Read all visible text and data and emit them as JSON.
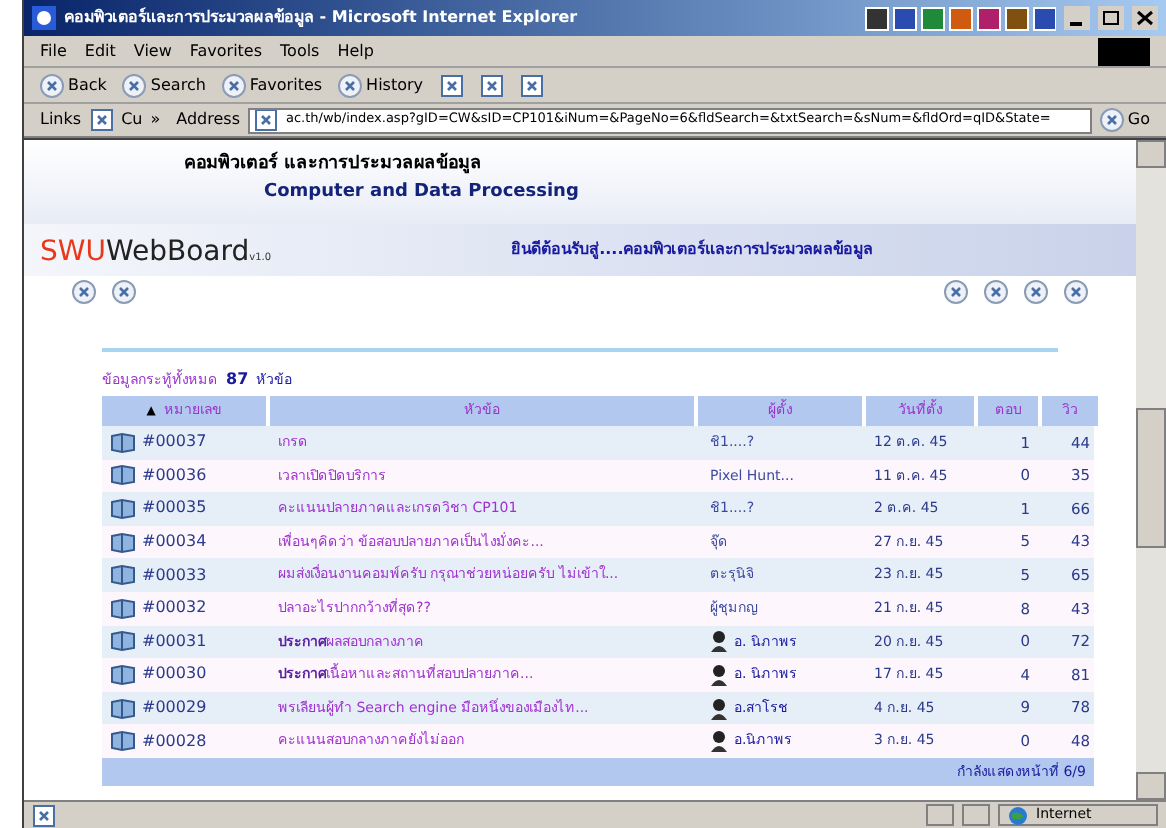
{
  "window": {
    "title": "คอมพิวเตอร์และการประมวลผลข้อมูล - Microsoft Internet Explorer"
  },
  "menu": [
    "File",
    "Edit",
    "View",
    "Favorites",
    "Tools",
    "Help"
  ],
  "toolbar": [
    "Back",
    "Search",
    "Favorites",
    "History"
  ],
  "links_bar": {
    "label": "Links",
    "item": "Cu",
    "more": "»"
  },
  "address": {
    "label": "Address",
    "value": "ac.th/wb/index.asp?gID=CW&sID=CP101&iNum=&PageNo=6&fldSearch=&txtSearch=&sNum=&fldOrd=qID&State=",
    "go": "Go"
  },
  "banner": {
    "title_th": "คอมพิวเตอร์ และการประมวลผลข้อมูล",
    "title_en": "Computer and Data Processing",
    "logo": "SWU",
    "logo_rest": "WebBoard",
    "version": "v1.0",
    "welcome": "ยินดีต้อนรับสู่....คอมพิวเตอร์และการประมวลผลข้อมูล"
  },
  "summary": {
    "label": "ข้อมูลกระทู้ทั้งหมด",
    "count": "87",
    "unit": "หัวข้อ"
  },
  "table": {
    "sort_mark": "▲",
    "columns": [
      "หมายเลข",
      "หัวข้อ",
      "ผู้ตั้ง",
      "วันที่ตั้ง",
      "ตอบ",
      "วิว"
    ],
    "rows": [
      {
        "number": "#00037",
        "topic": "เกรด",
        "author": "ชิ1....?",
        "admin": false,
        "date": "12 ต.ค. 45",
        "replies": "1",
        "views": "44"
      },
      {
        "number": "#00036",
        "topic": "เวลาเปิดปิดบริการ",
        "author": "Pixel Hunt...",
        "admin": false,
        "date": "11 ต.ค. 45",
        "replies": "0",
        "views": "35"
      },
      {
        "number": "#00035",
        "topic": "คะแนนปลายภาคและเกรดวิชา CP101",
        "author": "ชิ1....?",
        "admin": false,
        "date": "2 ต.ค. 45",
        "replies": "1",
        "views": "66"
      },
      {
        "number": "#00034",
        "topic": "เพื่อนๆคิดว่า ข้อสอบปลายภาคเป็นไงมั่งคะ...",
        "author": "จุ๊ด",
        "admin": false,
        "date": "27 ก.ย. 45",
        "replies": "5",
        "views": "43"
      },
      {
        "number": "#00033",
        "topic": "ผมส่งเงื่อนงานคอมพ์ครับ กรุณาช่วยหน่อยครับ ไม่เข้าใ...",
        "author": "ตะรุนิจิ",
        "admin": false,
        "date": "23 ก.ย. 45",
        "replies": "5",
        "views": "65"
      },
      {
        "number": "#00032",
        "topic": "ปลาอะไรปากกว้างที่สุด??",
        "author": "ผู้ชุมกญ",
        "admin": false,
        "date": "21 ก.ย. 45",
        "replies": "8",
        "views": "43"
      },
      {
        "number": "#00031",
        "topic": "**ประกาศ**ผลสอบกลางภาค",
        "author": "อ. นิภาพร",
        "admin": true,
        "date": "20 ก.ย. 45",
        "replies": "0",
        "views": "72"
      },
      {
        "number": "#00030",
        "topic": "**ประกาศ**เนื้อหาและสถานที่สอบปลายภาค...",
        "author": "อ. นิภาพร",
        "admin": true,
        "date": "17 ก.ย. 45",
        "replies": "4",
        "views": "81"
      },
      {
        "number": "#00029",
        "topic": "พรเลียนผู้ทำ Search engine มือหนึ่งของเมืองไท...",
        "author": "อ.สาโรช",
        "admin": true,
        "date": "4 ก.ย. 45",
        "replies": "9",
        "views": "78"
      },
      {
        "number": "#00028",
        "topic": "คะแนนสอบกลางภาคยังไม่ออก",
        "author": "อ.นิภาพร",
        "admin": true,
        "date": "3 ก.ย. 45",
        "replies": "0",
        "views": "48"
      }
    ],
    "footer": "กำลังแสดงหน้าที่ 6/9"
  },
  "status_bar": {
    "zone": "Internet"
  }
}
